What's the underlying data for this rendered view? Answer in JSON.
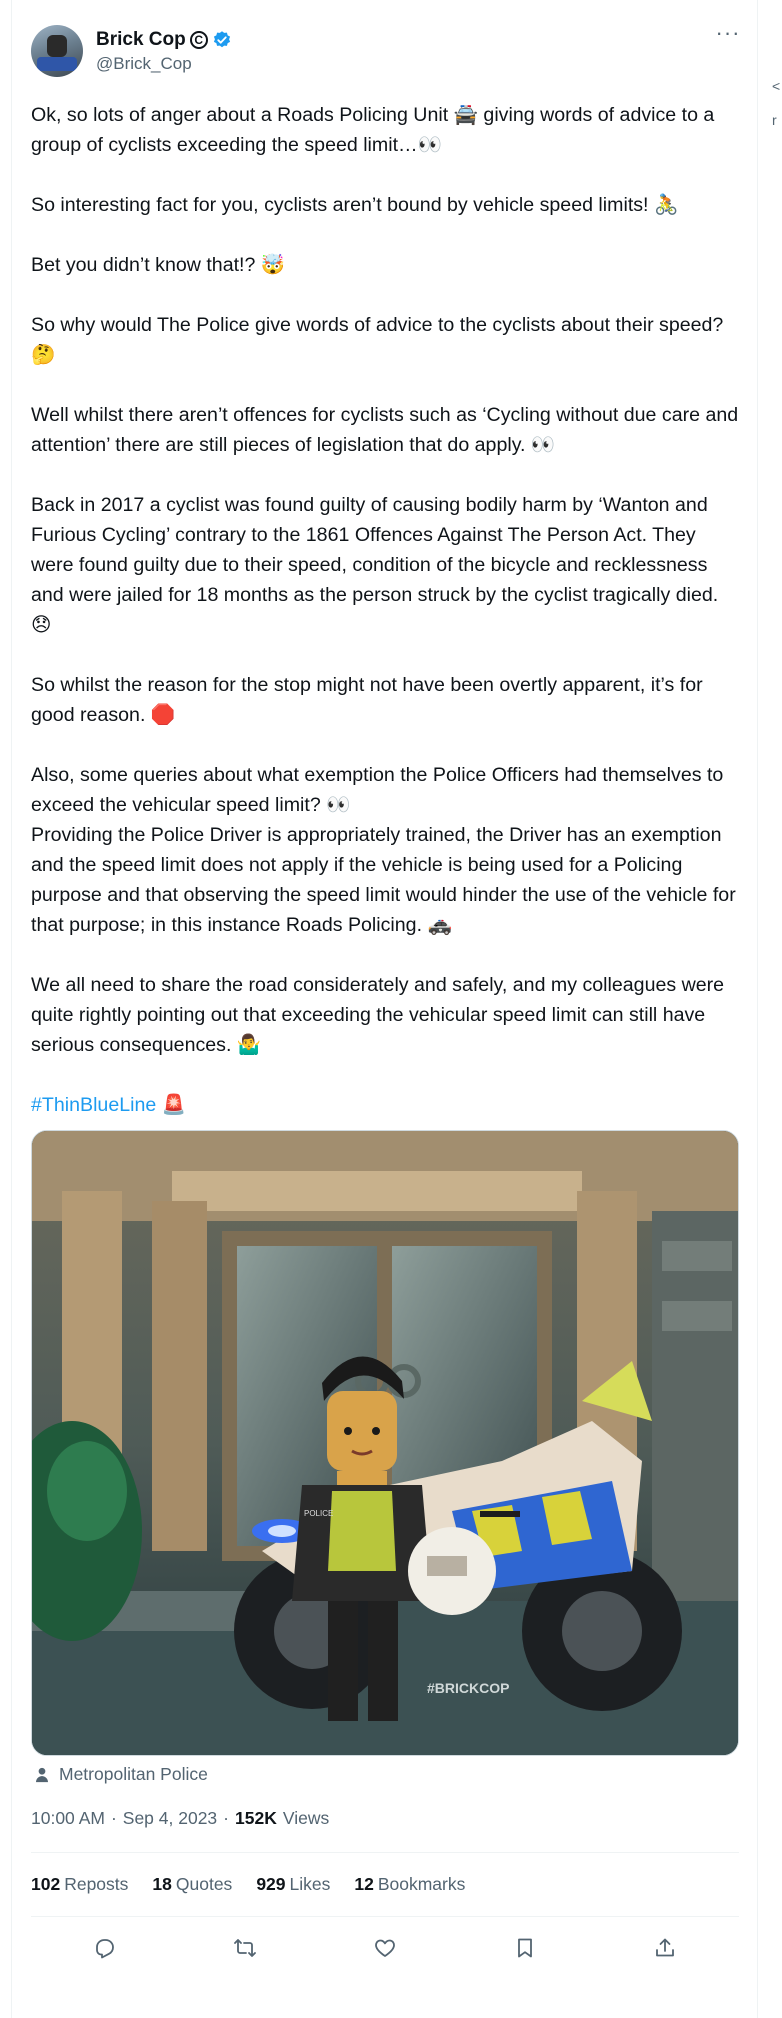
{
  "author": {
    "display_name": "Brick Cop",
    "badge_glyph": "C",
    "handle": "@Brick_Cop",
    "verified": true
  },
  "more_icon": "ellipsis-icon",
  "tweet": {
    "paragraphs": [
      "Ok, so lots of anger about a Roads Policing Unit 🚔 giving words of advice to a group of cyclists exceeding the speed limit…👀",
      "So interesting fact for you, cyclists aren’t bound by vehicle speed limits! 🚴",
      "Bet you didn’t know that!? 🤯",
      "So why would The Police give words of advice to the cyclists about their speed? 🤔",
      "Well whilst there aren’t offences for cyclists such as ‘Cycling without due care and attention’ there are still pieces of legislation that do apply. 👀",
      "Back in 2017 a cyclist was found guilty of causing bodily harm by ‘Wanton and Furious Cycling’ contrary to the 1861 Offences Against The Person Act. They were found guilty due to their speed, condition of the bicycle and recklessness and were jailed for 18 months as the person struck by the cyclist tragically died. 😞",
      "So whilst the reason for the stop might not have been overtly apparent, it’s for good reason. 🛑",
      "Also, some queries about what exemption the Police Officers had themselves to exceed the vehicular speed limit? 👀",
      "Providing the Police Driver is appropriately trained, the Driver has an exemption and the speed limit does not apply if the vehicle is being used for a Policing purpose and that observing the speed limit would hinder the use of the vehicle for that purpose; in this instance Roads Policing. 🚓",
      "We all need to share the road considerately and safely, and my colleagues were quite rightly pointing out that exceeding the vehicular speed limit can still have serious consequences. 🤷‍♂️"
    ],
    "hashtag": "#ThinBlueLine",
    "hashtag_emoji": "🚨"
  },
  "media": {
    "watermark": "#BRICKCOP",
    "vest_text": "POLICE"
  },
  "tagged": {
    "icon": "person-icon",
    "label": "Metropolitan Police"
  },
  "meta": {
    "time": "10:00 AM",
    "sep1": "·",
    "date": "Sep 4, 2023",
    "sep2": "·",
    "views_count": "152K",
    "views_label": "Views"
  },
  "stats": {
    "reposts_count": "102",
    "reposts_label": "Reposts",
    "quotes_count": "18",
    "quotes_label": "Quotes",
    "likes_count": "929",
    "likes_label": "Likes",
    "bookmarks_count": "12",
    "bookmarks_label": "Bookmarks"
  },
  "actions": [
    "reply-icon",
    "repost-icon",
    "like-icon",
    "bookmark-icon",
    "share-icon"
  ],
  "edge_fragments": [
    "<",
    "r"
  ],
  "colors": {
    "accent": "#1d9bf0",
    "secondary_text": "#536471",
    "primary_text": "#0f1419",
    "border": "#eff3f4"
  }
}
